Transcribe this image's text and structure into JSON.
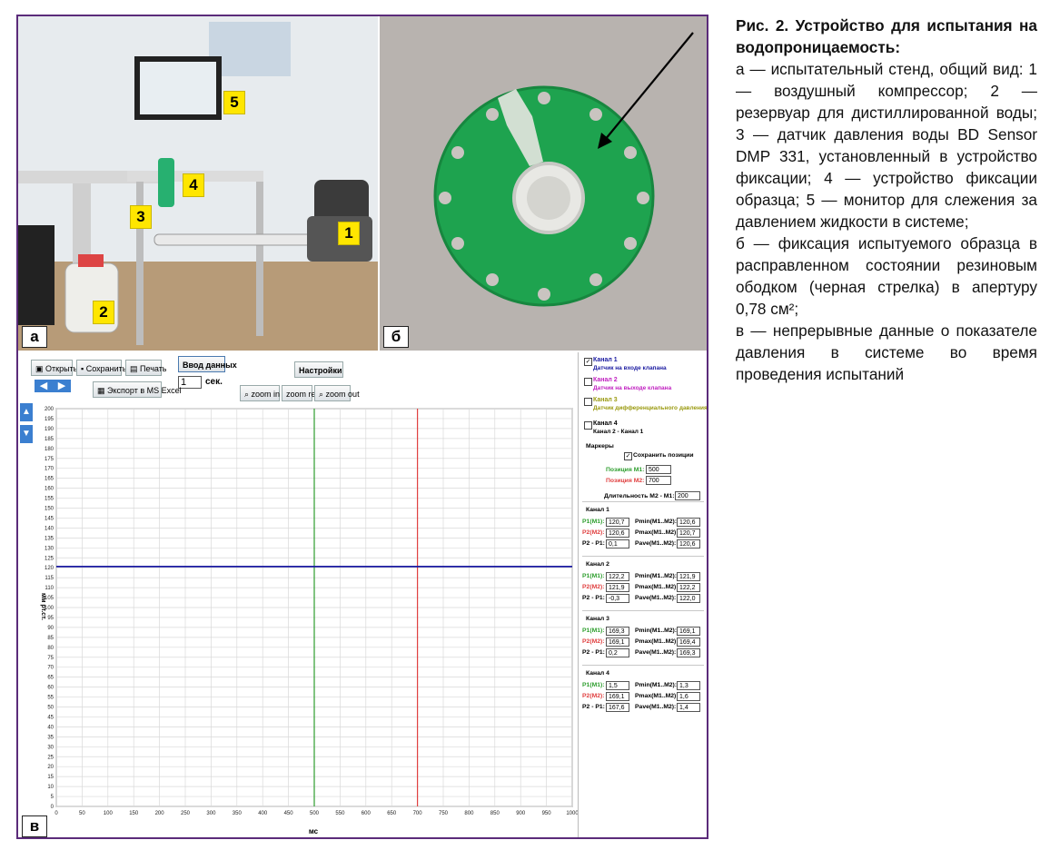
{
  "caption": {
    "title": "Рис. 2. Устройство для испытания на водопроницаемость:",
    "items": [
      "а — испытательный стенд, общий вид: 1 — воздушный компрессор; 2 — резервуар для дистиллированной воды; 3 — датчик давления воды BD Sensor DMP 331, установленный в устройство фиксации; 4 — устройство фиксации образца; 5 — монитор для слежения за давлением жидкости в системе;",
      "б — фиксация испытуемого образца в расправленном состоянии резиновым ободком (черная стрелка) в апертуру 0,78 см²;",
      "в — непрерывные данные о показателе давления в системе во время проведения испытаний"
    ]
  },
  "panel_labels": {
    "a": "а",
    "b": "б",
    "c": "в"
  },
  "photo_a_numbers": [
    "1",
    "2",
    "3",
    "4",
    "5"
  ],
  "software": {
    "toolbar": {
      "open": "Открыть",
      "save": "Сохранить",
      "print": "Печать",
      "export": "Экспорт в MS Excel",
      "data_input": "Ввод данных",
      "seconds_value": "1",
      "seconds_unit": "сек.",
      "settings": "Настройки",
      "zoom_in": "zoom in",
      "zoom_reset": "zoom reset",
      "zoom_out": "zoom out"
    },
    "channels": [
      {
        "label": "Канал 1",
        "sub": "Датчик на входе клапана",
        "checked": true,
        "color": "#1a1aa0"
      },
      {
        "label": "Канал 2",
        "sub": "Датчик на выходе клапана",
        "checked": false,
        "color": "#c020c0"
      },
      {
        "label": "Канал 3",
        "sub": "Датчик дифференциального давления",
        "checked": false,
        "color": "#9a9a10"
      },
      {
        "label": "Канал 4",
        "sub": "Канал 2 - Канал 1",
        "checked": false,
        "color": "#000000"
      }
    ],
    "markers": {
      "title": "Маркеры",
      "save_label": "Сохранить позиции",
      "m1_label": "Позиция М1:",
      "m1_value": "500",
      "m2_label": "Позиция М2:",
      "m2_value": "700",
      "duration_label": "Длительность М2 - М1:",
      "duration_value": "200"
    },
    "stats": [
      {
        "title": "Канал 1",
        "p1": "120,7",
        "p2": "120,6",
        "diff": "0,1",
        "pmin": "120,6",
        "pmax": "120,7",
        "pave": "120,6"
      },
      {
        "title": "Канал 2",
        "p1": "122,2",
        "p2": "121,9",
        "diff": "-0,3",
        "pmin": "121,9",
        "pmax": "122,2",
        "pave": "122,0"
      },
      {
        "title": "Канал 3",
        "p1": "169,3",
        "p2": "169,1",
        "diff": "0,2",
        "pmin": "169,1",
        "pmax": "169,4",
        "pave": "169,3"
      },
      {
        "title": "Канал 4",
        "p1": "1,5",
        "p2": "169,1",
        "diff": "167,6",
        "pmin": "1,3",
        "pmax": "1,6",
        "pave": "1,4"
      }
    ],
    "stat_labels": {
      "p1": "P1(M1):",
      "p2": "P2(M2):",
      "diff": "P2 - P1:",
      "pmin": "Pmin(M1..M2):",
      "pmax": "Pmax(M1..M2):",
      "pave": "Pave(M1..M2):"
    }
  },
  "chart_data": {
    "type": "line",
    "xlabel": "мс",
    "ylabel": "мм рт.ст.",
    "xlim": [
      0,
      1000
    ],
    "ylim": [
      0,
      200
    ],
    "x_ticks": [
      0,
      50,
      100,
      150,
      200,
      250,
      300,
      350,
      400,
      450,
      500,
      550,
      600,
      650,
      700,
      750,
      800,
      850,
      900,
      950,
      1000
    ],
    "y_ticks": [
      0,
      5,
      10,
      15,
      20,
      25,
      30,
      35,
      40,
      45,
      50,
      55,
      60,
      65,
      70,
      75,
      80,
      85,
      90,
      95,
      100,
      105,
      110,
      115,
      120,
      125,
      130,
      135,
      140,
      145,
      150,
      155,
      160,
      165,
      170,
      175,
      180,
      185,
      190,
      195,
      200
    ],
    "grid": true,
    "series": [
      {
        "name": "Канал 1",
        "color": "#1a1aa0",
        "x": [
          0,
          1000
        ],
        "y": [
          120.6,
          120.6
        ]
      }
    ],
    "markers": [
      {
        "name": "M1",
        "x": 500,
        "color": "#2e9e2e"
      },
      {
        "name": "M2",
        "x": 700,
        "color": "#e04040"
      }
    ]
  }
}
